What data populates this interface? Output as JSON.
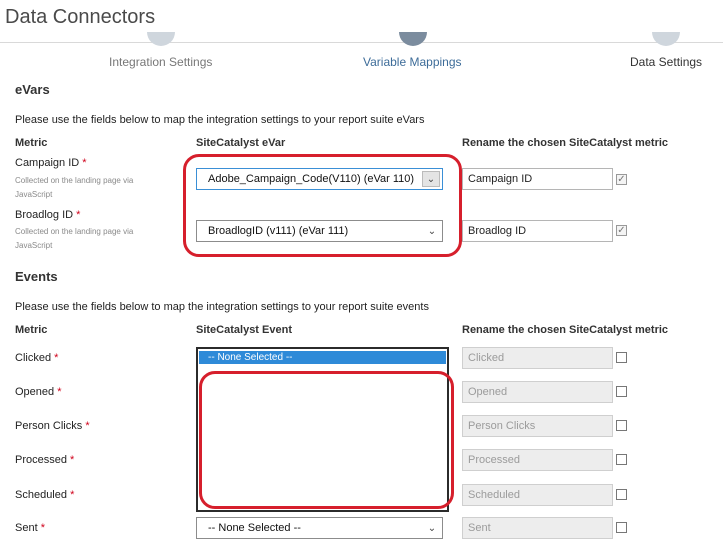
{
  "header": {
    "title": "Data Connectors"
  },
  "steps": [
    {
      "label": "Integration Settings"
    },
    {
      "label": "Variable Mappings"
    },
    {
      "label": "Data Settings"
    }
  ],
  "evars": {
    "section_title": "eVars",
    "hint": "Please use the fields below to map the integration settings to your report suite eVars",
    "col_metric": "Metric",
    "col_evar": "SiteCatalyst eVar",
    "col_rename": "Rename the chosen SiteCatalyst metric",
    "rows": [
      {
        "label": "Campaign ID",
        "required": "*",
        "sub1": "Collected on the landing page via",
        "sub2": "JavaScript",
        "selected": "Adobe_Campaign_Code(V110) (eVar 110)",
        "rename": "Campaign ID",
        "checked": "✓"
      },
      {
        "label": "Broadlog ID",
        "required": "*",
        "sub1": "Collected on the landing page via",
        "sub2": "JavaScript",
        "selected": "BroadlogID (v111) (eVar 111)",
        "rename": "Broadlog ID",
        "checked": "✓"
      }
    ]
  },
  "events": {
    "section_title": "Events",
    "hint": "Please use the fields below to map the integration settings to your report suite events",
    "col_metric": "Metric",
    "col_event": "SiteCatalyst Event",
    "col_rename": "Rename the chosen SiteCatalyst metric",
    "dropdown_selected": "-- None Selected --",
    "rows": [
      {
        "label": "Clicked",
        "required": "*",
        "placeholder": "Clicked"
      },
      {
        "label": "Opened",
        "required": "*",
        "placeholder": "Opened"
      },
      {
        "label": "Person Clicks",
        "required": "*",
        "placeholder": "Person Clicks"
      },
      {
        "label": "Processed",
        "required": "*",
        "placeholder": "Processed"
      },
      {
        "label": "Scheduled",
        "required": "*",
        "placeholder": "Scheduled"
      },
      {
        "label": "Sent",
        "required": "*",
        "placeholder": "Sent",
        "selected": "-- None Selected --"
      }
    ]
  },
  "colors": {
    "highlight": "#d61f2c",
    "selection": "#2e8ad8",
    "active_step": "#3d6c99"
  }
}
